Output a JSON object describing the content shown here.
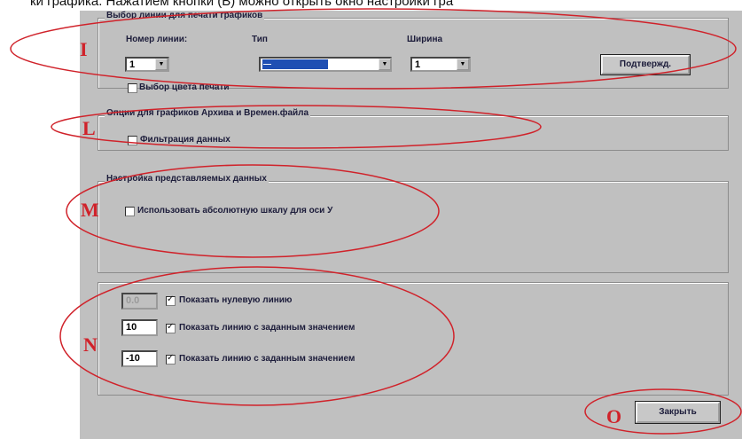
{
  "caption": "ки графика. Нажатием кнопки (B) можно открыть окно настройки гра",
  "group_lines": {
    "title": "Выбор линии для печати графиков",
    "line_number_label": "Номер линии:",
    "type_label": "Тип",
    "width_label": "Ширина",
    "line_number_value": "1",
    "type_value": "—",
    "width_value": "1",
    "confirm_button": "Подтвержд.",
    "print_color_label": "Выбор цвета печати",
    "print_color_checked": false
  },
  "group_archive": {
    "title": "Опции для графиков Архива и Времен.файла",
    "filter_label": "Фильтрация данных",
    "filter_checked": false
  },
  "group_display": {
    "title": "Настройка представляемых данных",
    "abs_scale_label": "Использовать абсолютную шкалу для оси У",
    "abs_scale_checked": false
  },
  "group_reference": {
    "rows": [
      {
        "value": "0.0",
        "label": "Показать нулевую линию",
        "checked": true,
        "disabled": true
      },
      {
        "value": "10",
        "label": "Показать линию с заданным значением",
        "checked": true,
        "disabled": false
      },
      {
        "value": "-10",
        "label": "Показать линию с заданным значением",
        "checked": true,
        "disabled": false
      }
    ]
  },
  "close_button": "Закрыть",
  "markers": {
    "i": "I",
    "l": "L",
    "m": "M",
    "n": "N",
    "o": "O"
  },
  "colors": {
    "dialog_bg": "#c0c0c0",
    "highlight": "#1f4fb3",
    "annotation": "#d0222a"
  }
}
